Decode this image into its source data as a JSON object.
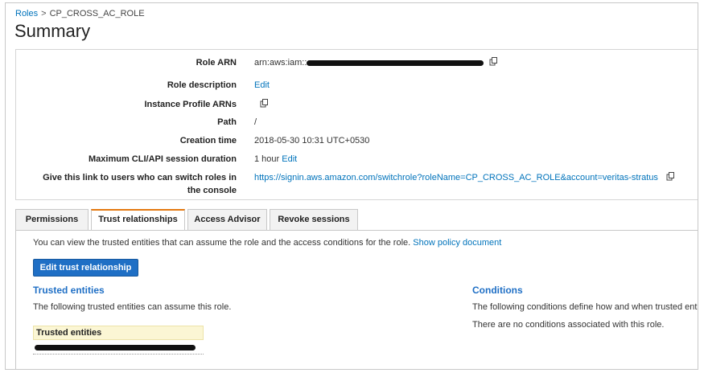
{
  "breadcrumb": {
    "roles_link": "Roles",
    "separator": ">",
    "current": "CP_CROSS_AC_ROLE"
  },
  "page_title": "Summary",
  "summary": {
    "role_arn_label": "Role ARN",
    "role_arn_value": "arn:aws:iam::",
    "role_description_label": "Role description",
    "role_description_value": "Edit",
    "instance_profile_label": "Instance Profile ARNs",
    "path_label": "Path",
    "path_value": "/",
    "creation_time_label": "Creation time",
    "creation_time_value": "2018-05-30 10:31 UTC+0530",
    "max_session_label": "Maximum CLI/API session duration",
    "max_session_value": "1 hour",
    "max_session_edit": "Edit",
    "switch_link_label_line1": "Give this link to users who can switch roles in",
    "switch_link_label_line2": "the console",
    "switch_link_value": "https://signin.aws.amazon.com/switchrole?roleName=CP_CROSS_AC_ROLE&account=veritas-stratus"
  },
  "tabs": [
    {
      "label": "Permissions"
    },
    {
      "label": "Trust relationships"
    },
    {
      "label": "Access Advisor"
    },
    {
      "label": "Revoke sessions"
    }
  ],
  "panel": {
    "intro_text": "You can view the trusted entities that can assume the role and the access conditions for the role.",
    "show_policy_link": "Show policy document",
    "edit_button": "Edit trust relationship",
    "trusted_title": "Trusted entities",
    "trusted_desc": "The following trusted entities can assume this role.",
    "trusted_table_header": "Trusted entities",
    "conditions_title": "Conditions",
    "conditions_desc": "The following conditions define how and when trusted entities",
    "conditions_none": "There are no conditions associated with this role."
  },
  "colors": {
    "link": "#0073bb",
    "primary_button": "#1f6fc5",
    "active_tab_accent": "#e47911",
    "table_header_bg": "#fbf6d4"
  },
  "icons": {
    "copy": "copy-icon"
  }
}
